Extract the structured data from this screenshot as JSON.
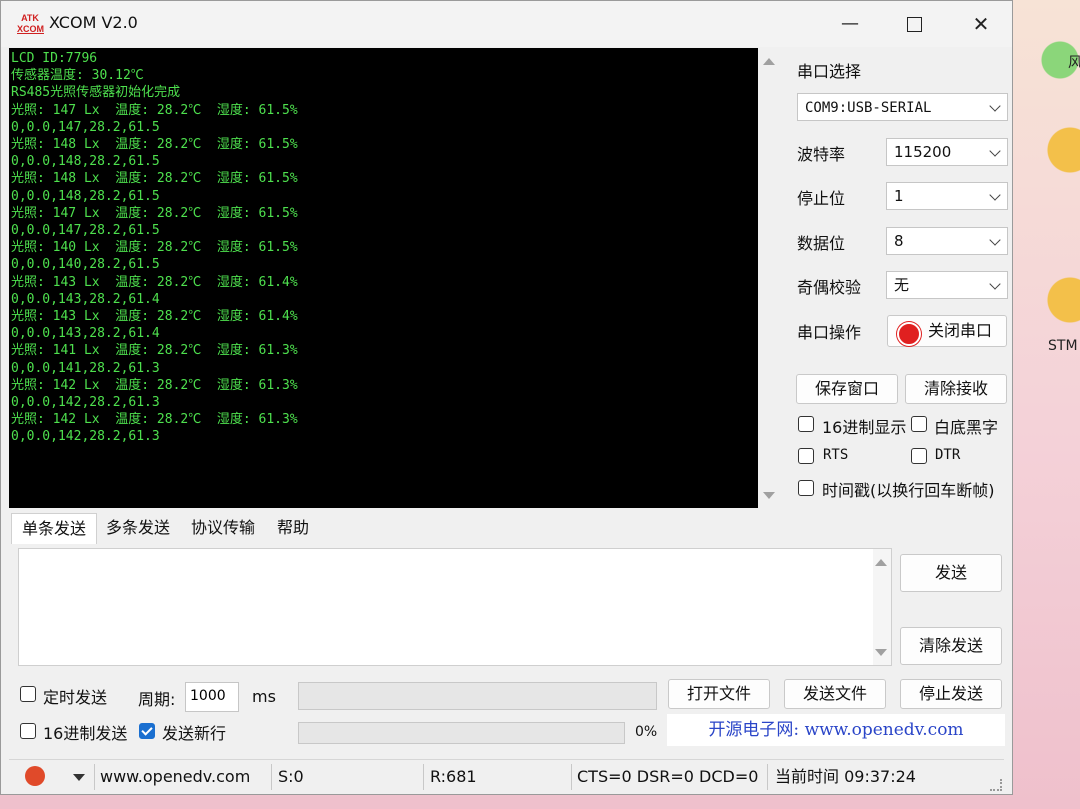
{
  "window": {
    "title": "XCOM V2.0",
    "logo_top": "ATK",
    "logo_bottom": "XCOM"
  },
  "terminal": {
    "lines": [
      "LCD ID:7796",
      "传感器温度: 30.12℃",
      "RS485光照传感器初始化完成",
      "光照: 147 Lx  温度: 28.2℃  湿度: 61.5%",
      "0,0.0,147,28.2,61.5",
      "光照: 148 Lx  温度: 28.2℃  湿度: 61.5%",
      "0,0.0,148,28.2,61.5",
      "光照: 148 Lx  温度: 28.2℃  湿度: 61.5%",
      "0,0.0,148,28.2,61.5",
      "光照: 147 Lx  温度: 28.2℃  湿度: 61.5%",
      "0,0.0,147,28.2,61.5",
      "光照: 140 Lx  温度: 28.2℃  湿度: 61.5%",
      "0,0.0,140,28.2,61.5",
      "光照: 143 Lx  温度: 28.2℃  湿度: 61.4%",
      "0,0.0,143,28.2,61.4",
      "光照: 143 Lx  温度: 28.2℃  湿度: 61.4%",
      "0,0.0,143,28.2,61.4",
      "光照: 141 Lx  温度: 28.2℃  湿度: 61.3%",
      "0,0.0,141,28.2,61.3",
      "光照: 142 Lx  温度: 28.2℃  湿度: 61.3%",
      "0,0.0,142,28.2,61.3",
      "光照: 142 Lx  温度: 28.2℃  湿度: 61.3%",
      "0,0.0,142,28.2,61.3"
    ]
  },
  "serial": {
    "section_title": "串口选择",
    "port": "COM9:USB-SERIAL",
    "baud_label": "波特率",
    "baud": "115200",
    "stop_label": "停止位",
    "stop": "1",
    "data_label": "数据位",
    "data_bits": "8",
    "parity_label": "奇偶校验",
    "parity": "无",
    "op_label": "串口操作",
    "op_button": "关闭串口",
    "save_window": "保存窗口",
    "clear_receive": "清除接收",
    "hex_display": "16进制显示",
    "white_black": "白底黑字",
    "rts": "RTS",
    "dtr": "DTR",
    "timestamp": "时间戳(以换行回车断帧)"
  },
  "tabs": [
    "单条发送",
    "多条发送",
    "协议传输",
    "帮助"
  ],
  "send": {
    "send_button": "发送",
    "clear_send": "清除发送",
    "timed_send": "定时发送",
    "period_label": "周期:",
    "period_value": "1000",
    "period_unit": "ms",
    "open_file": "打开文件",
    "send_file": "发送文件",
    "stop_send": "停止发送",
    "hex_send": "16进制发送",
    "send_newline": "发送新行",
    "progress": "0%",
    "website_banner": "开源电子网: www.openedv.com"
  },
  "status": {
    "site": "www.openedv.com",
    "sent": "S:0",
    "received": "R:681",
    "lines": "CTS=0 DSR=0 DCD=0",
    "time": "当前时间 09:37:24"
  },
  "desktop": {
    "label_1": "风",
    "label_2": "STM"
  }
}
